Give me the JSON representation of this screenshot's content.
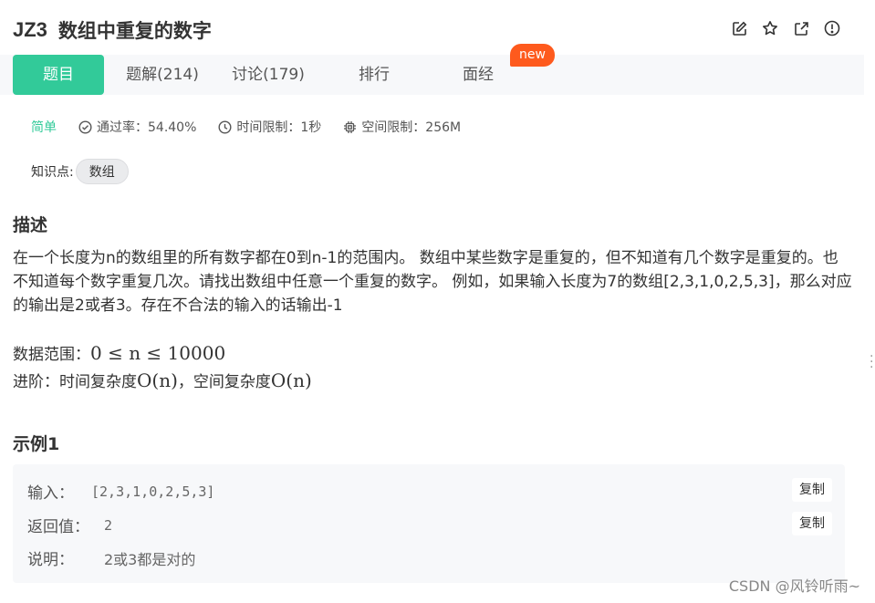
{
  "header": {
    "problem_id": "JZ3",
    "problem_name": "数组中重复的数字",
    "icons": [
      "edit-icon",
      "star-icon",
      "external-link-icon",
      "info-icon"
    ]
  },
  "tabs": [
    {
      "label": "题目",
      "active": true
    },
    {
      "label": "题解(214)"
    },
    {
      "label": "讨论(179)"
    },
    {
      "label": "排行"
    },
    {
      "label": "面经"
    }
  ],
  "new_badge": "new",
  "meta": {
    "difficulty": "简单",
    "pass_rate": "通过率：54.40%",
    "time_limit": "时间限制：1秒",
    "space_limit": "空间限制：256M"
  },
  "knowledge": {
    "label": "知识点:",
    "tag": "数组"
  },
  "description": {
    "title": "描述",
    "text": "在一个长度为n的数组里的所有数字都在0到n-1的范围内。 数组中某些数字是重复的，但不知道有几个数字是重复的。也不知道每个数字重复几次。请找出数组中任意一个重复的数字。 例如，如果输入长度为7的数组[2,3,1,0,2,5,3]，那么对应的输出是2或者3。存在不合法的输入的话输出-1",
    "range_label": "数据范围：",
    "range_formula": "0 ≤ n ≤ 10000",
    "advanced_label": "进阶：时间复杂度",
    "time_complexity": "O(n)",
    "separator": "，空间复杂度",
    "space_complexity": "O(n)"
  },
  "example": {
    "title": "示例1",
    "input_label": "输入：",
    "input_value": "[2,3,1,0,2,5,3]",
    "output_label": "返回值：",
    "output_value": "2",
    "explain_label": "说明：",
    "explain_value": "2或3都是对的",
    "copy_label": "复制"
  },
  "watermark": "CSDN @风铃听雨~",
  "colors": {
    "accent": "#32ca99",
    "badge": "#fe5a1d",
    "tab_bg": "#f7f8fa"
  }
}
